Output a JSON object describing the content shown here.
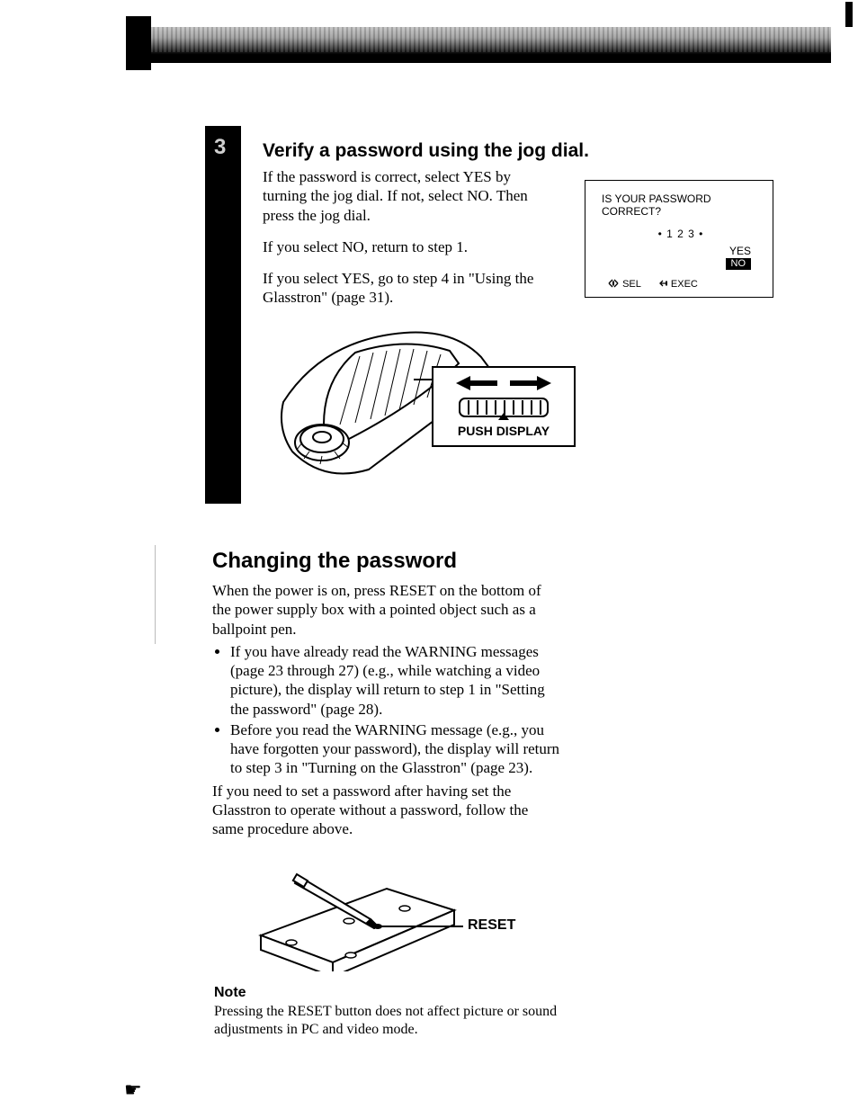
{
  "step3": {
    "number": "3",
    "title": "Verify a password using the jog dial.",
    "para1": "If the password is correct, select YES by turning the jog dial. If not, select NO. Then press the jog dial.",
    "para2": "If you select NO, return to step 1.",
    "para3": "If you select YES, go to step 4 in \"Using the Glasstron\" (page 31)."
  },
  "osd": {
    "line1": "IS YOUR PASSWORD",
    "line2": "CORRECT?",
    "password": "• 1 2 3 •",
    "yes": "YES",
    "no": "NO",
    "sel": "SEL",
    "exec": "EXEC"
  },
  "jog_callout": "PUSH DISPLAY",
  "changing": {
    "heading": "Changing the password",
    "intro": "When the power is on, press RESET on the bottom of the power supply box with a pointed object such as a ballpoint pen.",
    "b1": "If you have already read the WARNING messages (page 23 through 27) (e.g., while watching a video picture), the display will return to step 1 in \"Setting the password\" (page 28).",
    "b2": "Before you read the WARNING message (e.g., you have forgotten your password), the display will return to step 3 in \"Turning on the Glasstron\" (page 23).",
    "outro": "If you need to set a password after having set the Glasstron to operate without a password, follow the same procedure above."
  },
  "reset_label": "RESET",
  "note": {
    "heading": "Note",
    "body": "Pressing the RESET button does not affect picture or sound adjustments in PC and video mode."
  }
}
